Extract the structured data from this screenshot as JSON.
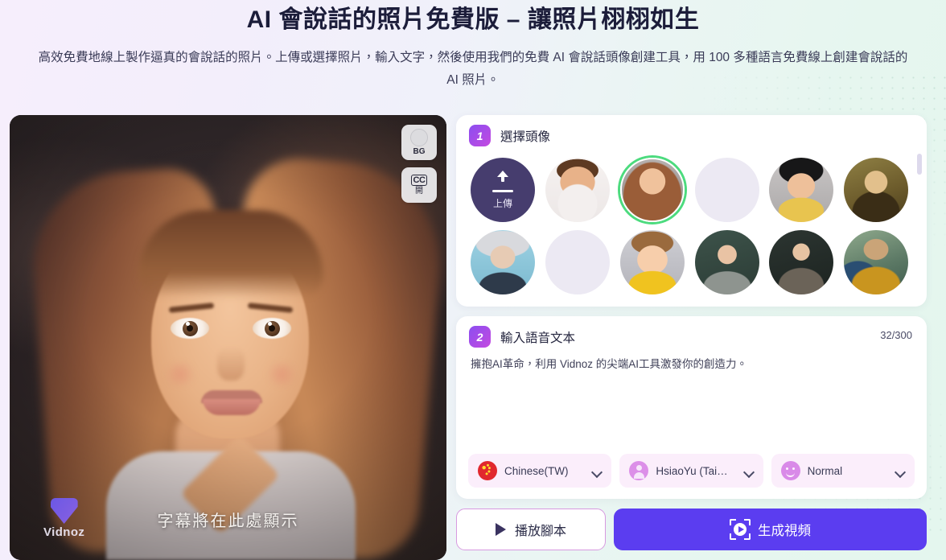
{
  "header": {
    "headline": "AI 會說話的照片免費版 – 讓照片栩栩如生",
    "subhead": "高效免費地線上製作逼真的會說話的照片。上傳或選擇照片，輸入文字，然後使用我們的免費 AI 會說話頭像創建工具，用 100 多種語言免費線上創建會說話的 AI 照片。"
  },
  "preview": {
    "bg_button_label": "BG",
    "cc_glyph": "CC",
    "cc_button_label": "開",
    "watermark_text": "Vidnoz",
    "subtitle_placeholder": "字幕將在此處顯示"
  },
  "step1": {
    "number": "1",
    "title": "選擇頭像",
    "upload_label": "上傳",
    "avatars": [
      {
        "name": "upload",
        "selected": false
      },
      {
        "name": "cartoon-young-man",
        "selected": false
      },
      {
        "name": "cartoon-long-hair-woman",
        "selected": true
      },
      {
        "name": "cartoon-bun-woman",
        "selected": false
      },
      {
        "name": "cartoon-black-hair-boy",
        "selected": false
      },
      {
        "name": "mona-lisa",
        "selected": false
      },
      {
        "name": "einstein",
        "selected": false
      },
      {
        "name": "cartoon-girl-yellow",
        "selected": false
      },
      {
        "name": "cartoon-boy-yellow-jacket",
        "selected": false
      },
      {
        "name": "teacher-woman",
        "selected": false
      },
      {
        "name": "teacher-man-glasses",
        "selected": false
      },
      {
        "name": "monkey-king-warrior",
        "selected": false
      }
    ]
  },
  "step2": {
    "number": "2",
    "title": "輸入語音文本",
    "char_count": "32/300",
    "script_text": "擁抱AI革命，利用 Vidnoz 的尖端AI工具激發你的創造力。",
    "script_placeholder": "輸入語音文本",
    "selectors": [
      {
        "icon": "flag-china-icon",
        "label": "Chinese(TW)",
        "name": "language-selector"
      },
      {
        "icon": "person-icon",
        "label": "HsiaoYu (Tai…",
        "name": "voice-selector"
      },
      {
        "icon": "smiley-icon",
        "label": "Normal",
        "name": "style-selector"
      }
    ]
  },
  "actions": {
    "play_label": "播放腳本",
    "generate_label": "生成視頻"
  },
  "colors": {
    "accent_purple": "#5b3df0",
    "badge_gradient_start": "#8b4ef0",
    "badge_gradient_end": "#c44ae0",
    "selected_ring": "#4cdb7e",
    "selector_bg": "#fbeefb",
    "upload_bg": "#463d6e"
  }
}
